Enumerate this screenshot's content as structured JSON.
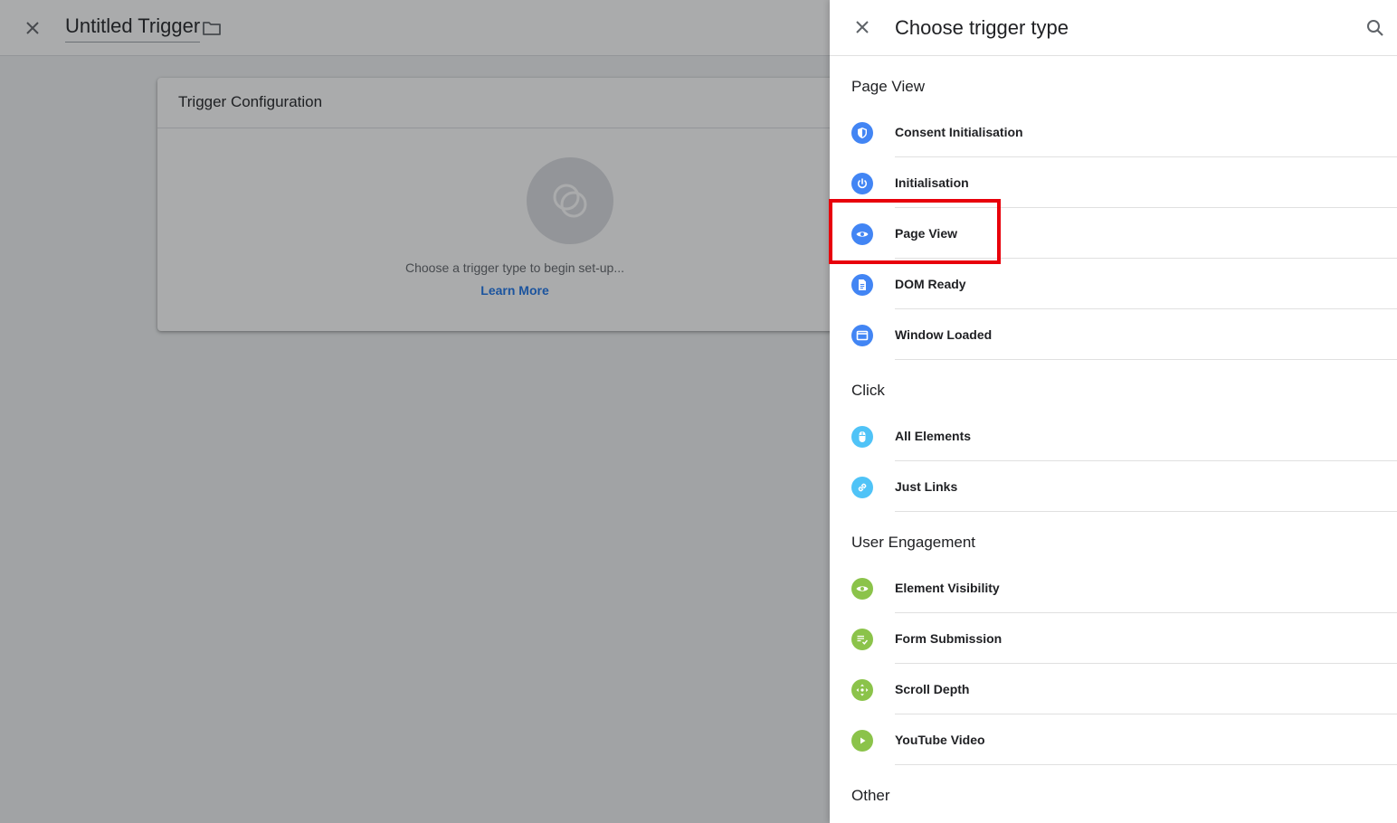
{
  "editor": {
    "title": "Untitled Trigger",
    "card_title": "Trigger Configuration",
    "hint": "Choose a trigger type to begin set-up...",
    "learn_more": "Learn More"
  },
  "panel": {
    "title": "Choose trigger type",
    "sections": [
      {
        "label": "Page View",
        "items": [
          {
            "label": "Consent Initialisation",
            "icon": "shield-icon",
            "color": "#4285f4"
          },
          {
            "label": "Initialisation",
            "icon": "power-icon",
            "color": "#4285f4"
          },
          {
            "label": "Page View",
            "icon": "eye-icon",
            "color": "#4285f4",
            "highlighted": true
          },
          {
            "label": "DOM Ready",
            "icon": "document-icon",
            "color": "#4285f4"
          },
          {
            "label": "Window Loaded",
            "icon": "window-icon",
            "color": "#4285f4"
          }
        ]
      },
      {
        "label": "Click",
        "items": [
          {
            "label": "All Elements",
            "icon": "mouse-icon",
            "color": "#4fc3f7"
          },
          {
            "label": "Just Links",
            "icon": "link-icon",
            "color": "#4fc3f7"
          }
        ]
      },
      {
        "label": "User Engagement",
        "items": [
          {
            "label": "Element Visibility",
            "icon": "eye-icon",
            "color": "#8bc34a"
          },
          {
            "label": "Form Submission",
            "icon": "form-check-icon",
            "color": "#8bc34a"
          },
          {
            "label": "Scroll Depth",
            "icon": "scroll-arrows-icon",
            "color": "#8bc34a"
          },
          {
            "label": "YouTube Video",
            "icon": "play-icon",
            "color": "#8bc34a"
          }
        ]
      },
      {
        "label": "Other",
        "items": []
      }
    ]
  },
  "colors": {
    "accent": "#1a73e8",
    "highlight": "#e8000b"
  }
}
